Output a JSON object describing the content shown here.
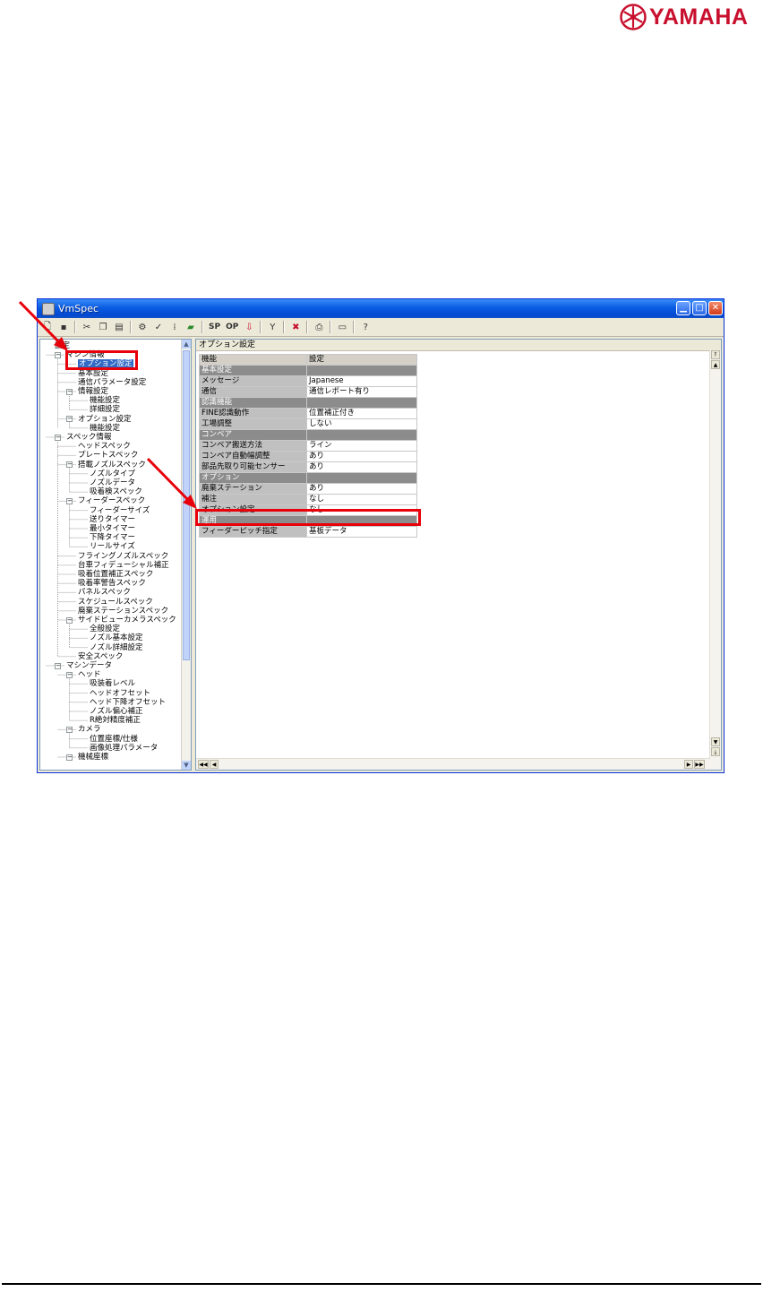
{
  "brand": {
    "name": "YAMAHA",
    "color": "#c8102e",
    "icon": "yamaha-tuning-fork-icon"
  },
  "window": {
    "title": "VmSpec",
    "controls": [
      "minimize-icon",
      "maximize-icon",
      "close-icon"
    ]
  },
  "toolbar": {
    "sp_label": "SP",
    "op_label": "OP",
    "icons": [
      "new-file-icon",
      "save-icon",
      "cut-icon",
      "copy-icon",
      "paste-icon",
      "gear-icon",
      "gear-check-icon",
      "grid-icon",
      "folder-icon",
      "filter-icon",
      "delete-icon",
      "print-icon",
      "keyboard-icon",
      "help-icon"
    ]
  },
  "tree": {
    "items": [
      {
        "label": "設定"
      },
      {
        "label": "マシン情報"
      },
      {
        "label": "オプション設定",
        "selected": true
      },
      {
        "label": "基本設定"
      },
      {
        "label": "通信パラメータ設定"
      },
      {
        "label": "情報設定"
      },
      {
        "label": "機能設定"
      },
      {
        "label": "詳細設定"
      },
      {
        "label": "オプション設定"
      },
      {
        "label": "機能設定"
      },
      {
        "label": "スペック情報"
      },
      {
        "label": "ヘッドスペック"
      },
      {
        "label": "プレートスペック"
      },
      {
        "label": "搭載ノズルスペック"
      },
      {
        "label": "ノズルタイプ"
      },
      {
        "label": "ノズルデータ"
      },
      {
        "label": "吸着検スペック"
      },
      {
        "label": "フィーダースペック"
      },
      {
        "label": "フィーダーサイズ"
      },
      {
        "label": "送りタイマー"
      },
      {
        "label": "最小タイマー"
      },
      {
        "label": "下降タイマー"
      },
      {
        "label": "リールサイズ"
      },
      {
        "label": "フライングノズルスペック"
      },
      {
        "label": "台車フィデューシャル補正"
      },
      {
        "label": "吸着位置補正スペック"
      },
      {
        "label": "吸着率警告スペック"
      },
      {
        "label": "パネルスペック"
      },
      {
        "label": "スケジュールスペック"
      },
      {
        "label": "廃棄ステーションスペック"
      },
      {
        "label": "サイドビューカメラスペック"
      },
      {
        "label": "全般設定"
      },
      {
        "label": "ノズル基本設定"
      },
      {
        "label": "ノズル詳細設定"
      },
      {
        "label": "安全スペック"
      },
      {
        "label": "マシンデータ"
      },
      {
        "label": "ヘッド"
      },
      {
        "label": "吸装着レベル"
      },
      {
        "label": "ヘッドオフセット"
      },
      {
        "label": "ヘッド下降オフセット"
      },
      {
        "label": "ノズル偏心補正"
      },
      {
        "label": "R絶対精度補正"
      },
      {
        "label": "カメラ"
      },
      {
        "label": "位置座標/仕様"
      },
      {
        "label": "画像処理パラメータ"
      },
      {
        "label": "機械座標"
      }
    ]
  },
  "main": {
    "heading": "オプション設定",
    "columns": [
      "機能",
      "設定"
    ],
    "rows": [
      {
        "type": "group",
        "name": "基本設定",
        "value": ""
      },
      {
        "type": "item",
        "name": "メッセージ",
        "value": "Japanese"
      },
      {
        "type": "item",
        "name": "通信",
        "value": "通信レポート有り"
      },
      {
        "type": "group",
        "name": "認識機能",
        "value": ""
      },
      {
        "type": "item",
        "name": "FINE認識動作",
        "value": "位置補正付き"
      },
      {
        "type": "item",
        "name": "工場調整",
        "value": "しない"
      },
      {
        "type": "group",
        "name": "コンベア",
        "value": ""
      },
      {
        "type": "item",
        "name": "コンベア搬送方法",
        "value": "ライン"
      },
      {
        "type": "item",
        "name": "コンベア自動幅調整",
        "value": "あり"
      },
      {
        "type": "item",
        "name": "部品先取り可能センサー",
        "value": "あり"
      },
      {
        "type": "group",
        "name": "オプション",
        "value": ""
      },
      {
        "type": "item",
        "name": "廃棄ステーション",
        "value": "あり",
        "highlight": true
      },
      {
        "type": "item",
        "name": "補注",
        "value": "なし"
      },
      {
        "type": "item",
        "name": "オプション設定",
        "value": "なし"
      },
      {
        "type": "group",
        "name": "運用",
        "value": ""
      },
      {
        "type": "item",
        "name": "フィーダーピッチ指定",
        "value": "基板データ"
      }
    ]
  },
  "annotation_color": "#e8000b"
}
